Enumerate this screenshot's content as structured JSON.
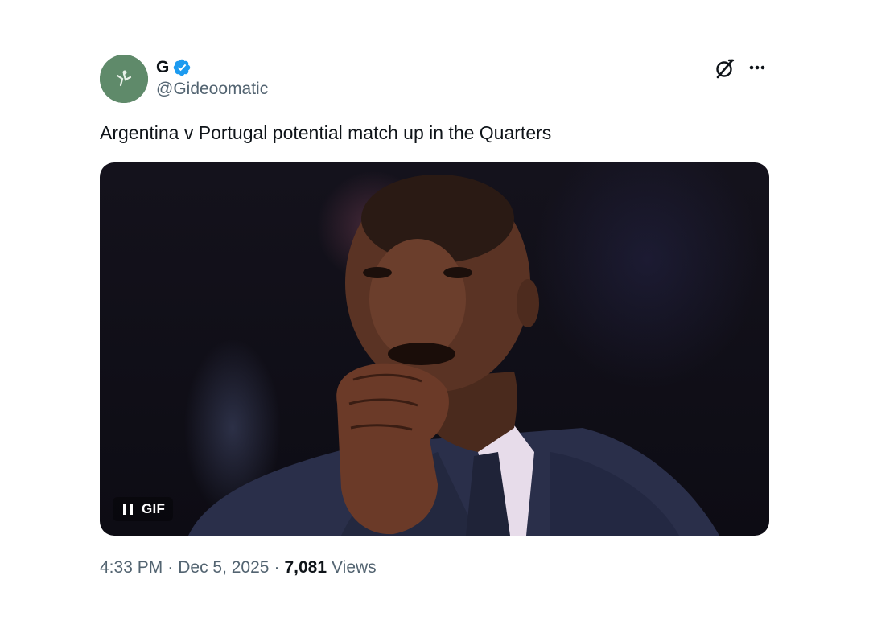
{
  "author": {
    "display_name": "G",
    "handle": "@Gideoomatic",
    "verified": true,
    "avatar_icon": "avatar"
  },
  "tweet": {
    "text": "Argentina v Portugal potential match up in the Quarters"
  },
  "header_actions": {
    "grok_icon": "grok-icon",
    "more_icon": "more-icon"
  },
  "media": {
    "type": "gif",
    "badge_label": "GIF",
    "control_icon": "pause-icon"
  },
  "meta": {
    "time": "4:33 PM",
    "separator": "·",
    "date": "Dec 5, 2025",
    "views_count": "7,081",
    "views_label": "Views"
  },
  "colors": {
    "text_primary": "#0f1419",
    "text_secondary": "#536471",
    "verified_blue": "#1d9bf0"
  }
}
